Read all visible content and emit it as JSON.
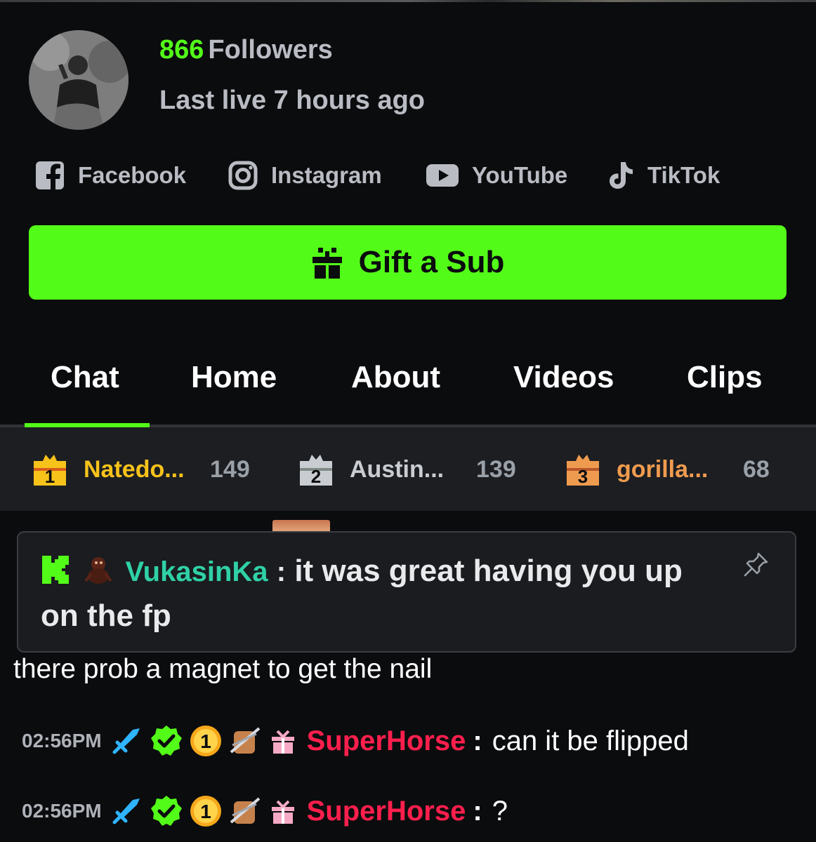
{
  "profile": {
    "followers_count": "866",
    "followers_label": "Followers",
    "last_live": "Last live 7 hours ago"
  },
  "socials": [
    {
      "label": "Facebook",
      "icon": "facebook-icon"
    },
    {
      "label": "Instagram",
      "icon": "instagram-icon"
    },
    {
      "label": "YouTube",
      "icon": "youtube-icon"
    },
    {
      "label": "TikTok",
      "icon": "tiktok-icon"
    }
  ],
  "gift_button": {
    "label": "Gift a Sub",
    "icon": "gift-icon"
  },
  "tabs": [
    {
      "label": "Chat",
      "active": true
    },
    {
      "label": "Home"
    },
    {
      "label": "About"
    },
    {
      "label": "Videos"
    },
    {
      "label": "Clips"
    }
  ],
  "leaderboard": [
    {
      "rank": "1",
      "name": "Natedo...",
      "score": "149",
      "color": "#f7c21a"
    },
    {
      "rank": "2",
      "name": "Austin...",
      "score": "139",
      "color": "#c9ccd1"
    },
    {
      "rank": "3",
      "name": "gorilla...",
      "score": "68",
      "color": "#ef9b4f"
    }
  ],
  "pinned": {
    "username": "VukasinKa",
    "separator": ":",
    "line1": "it was great having you up",
    "line2": "on the fp"
  },
  "messages": {
    "plain": "there prob a magnet to get the nail",
    "rows": [
      {
        "time": "02:56PM",
        "user": "SuperHorse",
        "sep": ":",
        "text": "can it be flipped"
      },
      {
        "time": "02:56PM",
        "user": "SuperHorse",
        "sep": ":",
        "text": "?"
      }
    ]
  },
  "colors": {
    "accent": "#53fc18",
    "background": "#0b0c0e",
    "username_pinned": "#2fd1a6",
    "username_chat": "#ff1f4d"
  }
}
